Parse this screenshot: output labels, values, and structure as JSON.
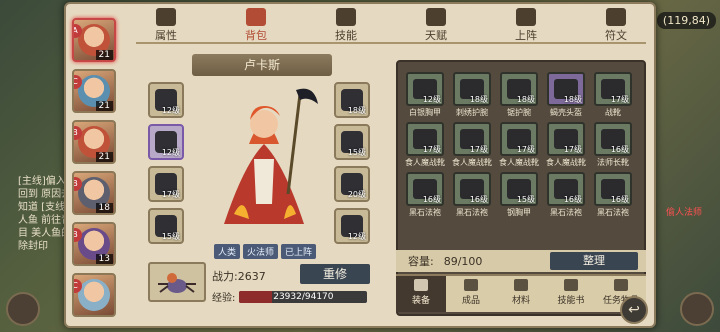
{
  "currency": "(119,84)",
  "tabs": [
    {
      "label": "属性",
      "icon": "flame-icon"
    },
    {
      "label": "背包",
      "icon": "bag-icon",
      "active": true
    },
    {
      "label": "技能",
      "icon": "book-icon"
    },
    {
      "label": "天赋",
      "icon": "eye-icon"
    },
    {
      "label": "上阵",
      "icon": "swords-icon"
    },
    {
      "label": "符文",
      "icon": "rune-icon"
    }
  ],
  "hero": {
    "name": "卢卡斯",
    "tags": [
      "人类",
      "火法师",
      "已上阵"
    ],
    "power_label": "战力:2637",
    "rebuild_label": "重修",
    "exp_label": "经验:",
    "exp_text": "23932/94170",
    "exp_fraction": 0.254
  },
  "characters": [
    {
      "level": "21",
      "selected": true,
      "badge": "A",
      "color": "#c0523a"
    },
    {
      "level": "21",
      "badge": "C",
      "color": "#5a8fb0"
    },
    {
      "level": "21",
      "badge": "B",
      "color": "#c0523a"
    },
    {
      "level": "18",
      "badge": "B",
      "color": "#5d5f6e"
    },
    {
      "level": "13",
      "badge": "B",
      "color": "#6a4b8a"
    },
    {
      "level": "",
      "badge": "C",
      "color": "#8ab0c8"
    }
  ],
  "equip_left": [
    {
      "lv": "12级",
      "purple": false
    },
    {
      "lv": "12级",
      "purple": true
    },
    {
      "lv": "17级",
      "purple": false
    },
    {
      "lv": "15级",
      "purple": false
    }
  ],
  "equip_right": [
    {
      "lv": "18级",
      "purple": false
    },
    {
      "lv": "15级",
      "purple": false
    },
    {
      "lv": "20级",
      "purple": false
    },
    {
      "lv": "12级",
      "purple": false
    }
  ],
  "bag_items": [
    {
      "name": "白银胸甲",
      "lv": "12级",
      "purple": false
    },
    {
      "name": "刺绣护腕",
      "lv": "18级",
      "purple": false
    },
    {
      "name": "锯护腕",
      "lv": "18级",
      "purple": false
    },
    {
      "name": "蝎壳头盔",
      "lv": "18级",
      "purple": true
    },
    {
      "name": "战靴",
      "lv": "17级",
      "purple": false
    },
    {
      "name": "食人魔战靴",
      "lv": "17级",
      "purple": false
    },
    {
      "name": "食人魔战靴",
      "lv": "17级",
      "purple": false
    },
    {
      "name": "食人魔战靴",
      "lv": "17级",
      "purple": false
    },
    {
      "name": "食人魔战靴",
      "lv": "17级",
      "purple": false
    },
    {
      "name": "法师长靴",
      "lv": "16级",
      "purple": false
    },
    {
      "name": "黑石法袍",
      "lv": "16级",
      "purple": false
    },
    {
      "name": "黑石法袍",
      "lv": "16级",
      "purple": false
    },
    {
      "name": "钢胸甲",
      "lv": "15级",
      "purple": false
    },
    {
      "name": "黑石法袍",
      "lv": "16级",
      "purple": false
    },
    {
      "name": "黑石法袍",
      "lv": "16级",
      "purple": false
    }
  ],
  "capacity": {
    "label": "容量:",
    "value": "89/100"
  },
  "organize_label": "整理",
  "bag_tabs": [
    {
      "label": "装备",
      "active": true
    },
    {
      "label": "成品"
    },
    {
      "label": "材料"
    },
    {
      "label": "技能书"
    },
    {
      "label": "任务物品"
    }
  ],
  "background": {
    "left_text": "[主线]偏入 回到 原因去知道 [支线]人鱼 前往青目 美人鱼的 除封印",
    "right_text": "偷人法师"
  }
}
